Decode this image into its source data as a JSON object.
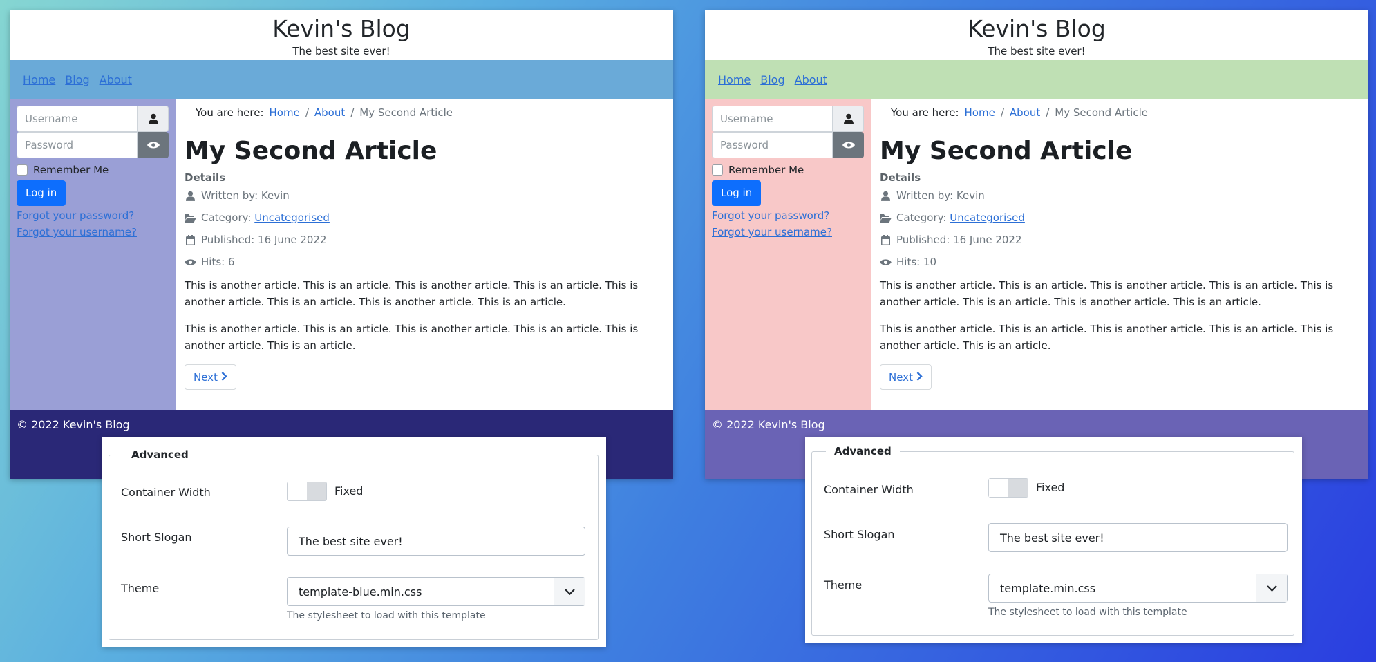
{
  "left": {
    "site": {
      "title": "Kevin's Blog",
      "slogan": "The best site ever!",
      "nav": [
        "Home",
        "Blog",
        "About"
      ],
      "colors": {
        "nav_bg": "#6aaad8",
        "sidebar_bg": "#9a9fd6",
        "footer_bg": "#2a2877"
      },
      "login": {
        "username_placeholder": "Username",
        "password_placeholder": "Password",
        "remember_label": "Remember Me",
        "login_button": "Log in",
        "forgot_password": "Forgot your password?",
        "forgot_username": "Forgot your username?"
      },
      "breadcrumb": {
        "prefix": "You are here:",
        "home": "Home",
        "sep": "/",
        "about": "About",
        "current": "My Second Article"
      },
      "article": {
        "title": "My Second Article",
        "details_label": "Details",
        "written_by": "Written by: Kevin",
        "category_prefix": "Category: ",
        "category": "Uncategorised",
        "published": "Published: 16 June 2022",
        "hits": "Hits: 6",
        "para1": "This is another article. This is an article. This is another article. This is an article. This is another article. This is an article. This is another article. This is an article.",
        "para2": "This is another article. This is an article. This is another article. This is an article. This is another article. This is an article.",
        "next": "Next"
      },
      "footer": "© 2022 Kevin's Blog"
    },
    "panel": {
      "legend": "Advanced",
      "container_width_label": "Container Width",
      "toggle_label": "Fixed",
      "slogan_label": "Short Slogan",
      "slogan_value": "The best site ever!",
      "theme_label": "Theme",
      "theme_value": "template-blue.min.css",
      "theme_hint": "The stylesheet to load with this template"
    }
  },
  "right": {
    "site": {
      "title": "Kevin's Blog",
      "slogan": "The best site ever!",
      "nav": [
        "Home",
        "Blog",
        "About"
      ],
      "colors": {
        "nav_bg": "#bfe0b4",
        "sidebar_bg": "#f8c8c8",
        "footer_bg": "#6a63b5"
      },
      "login": {
        "username_placeholder": "Username",
        "password_placeholder": "Password",
        "remember_label": "Remember Me",
        "login_button": "Log in",
        "forgot_password": "Forgot your password?",
        "forgot_username": "Forgot your username?"
      },
      "breadcrumb": {
        "prefix": "You are here:",
        "home": "Home",
        "sep": "/",
        "about": "About",
        "current": "My Second Article"
      },
      "article": {
        "title": "My Second Article",
        "details_label": "Details",
        "written_by": "Written by: Kevin",
        "category_prefix": "Category: ",
        "category": "Uncategorised",
        "published": "Published: 16 June 2022",
        "hits": "Hits: 10",
        "para1": "This is another article. This is an article. This is another article. This is an article. This is another article. This is an article. This is another article. This is an article.",
        "para2": "This is another article. This is an article. This is another article. This is an article. This is another article. This is an article.",
        "next": "Next"
      },
      "footer": "© 2022 Kevin's Blog"
    },
    "panel": {
      "legend": "Advanced",
      "container_width_label": "Container Width",
      "toggle_label": "Fixed",
      "slogan_label": "Short Slogan",
      "slogan_value": "The best site ever!",
      "theme_label": "Theme",
      "theme_value": "template.min.css",
      "theme_hint": "The stylesheet to load with this template"
    }
  },
  "icons": {
    "user": "user-icon",
    "eye": "eye-icon",
    "folder": "folder-open-icon",
    "calendar": "calendar-icon",
    "chevron_right": "chevron-right-icon",
    "chevron_down": "chevron-down-icon"
  }
}
